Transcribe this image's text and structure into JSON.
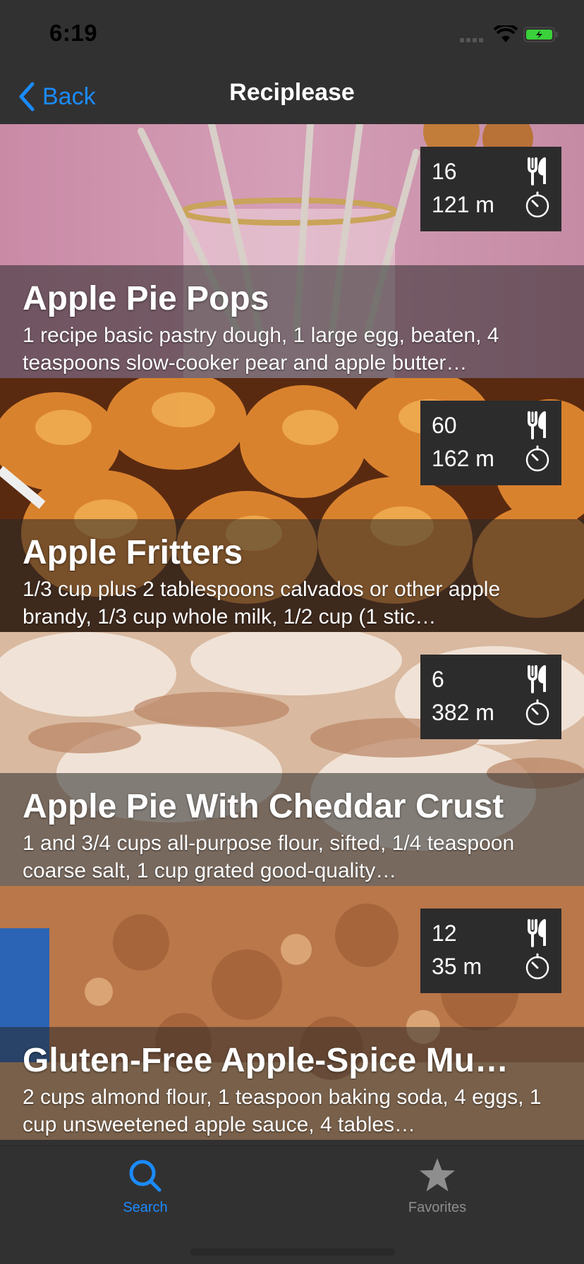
{
  "status_bar": {
    "time": "6:19"
  },
  "nav": {
    "back_label": "Back",
    "title": "Reciplease"
  },
  "recipes": [
    {
      "title": "Apple Pie Pops",
      "ingredients": "1 recipe basic pastry dough, 1 large egg, beaten, 4 teaspoons slow-cooker pear and apple butter…",
      "yield": "16",
      "time": "121 m"
    },
    {
      "title": "Apple Fritters",
      "ingredients": "1/3 cup plus 2 tablespoons calvados or other apple brandy, 1/3 cup whole milk, 1/2 cup (1 stic…",
      "yield": "60",
      "time": "162 m"
    },
    {
      "title": "Apple Pie With Cheddar Crust",
      "ingredients": "1 and 3/4 cups all-purpose flour, sifted, 1/4 teaspoon coarse salt, 1 cup grated good-quality…",
      "yield": "6",
      "time": "382 m"
    },
    {
      "title": "Gluten-Free Apple-Spice Mu…",
      "ingredients": "2 cups almond flour, 1 teaspoon baking soda, 4 eggs, 1 cup unsweetened apple sauce, 4 tables…",
      "yield": "12",
      "time": "35 m"
    }
  ],
  "tabs": [
    {
      "label": "Search",
      "icon": "search-icon",
      "active": true
    },
    {
      "label": "Favorites",
      "icon": "star-icon",
      "active": false
    }
  ],
  "colors": {
    "accent": "#1b8bff",
    "background": "#323131",
    "info_box": "#2d2c2c",
    "inactive_tab": "#8e8e8e"
  }
}
